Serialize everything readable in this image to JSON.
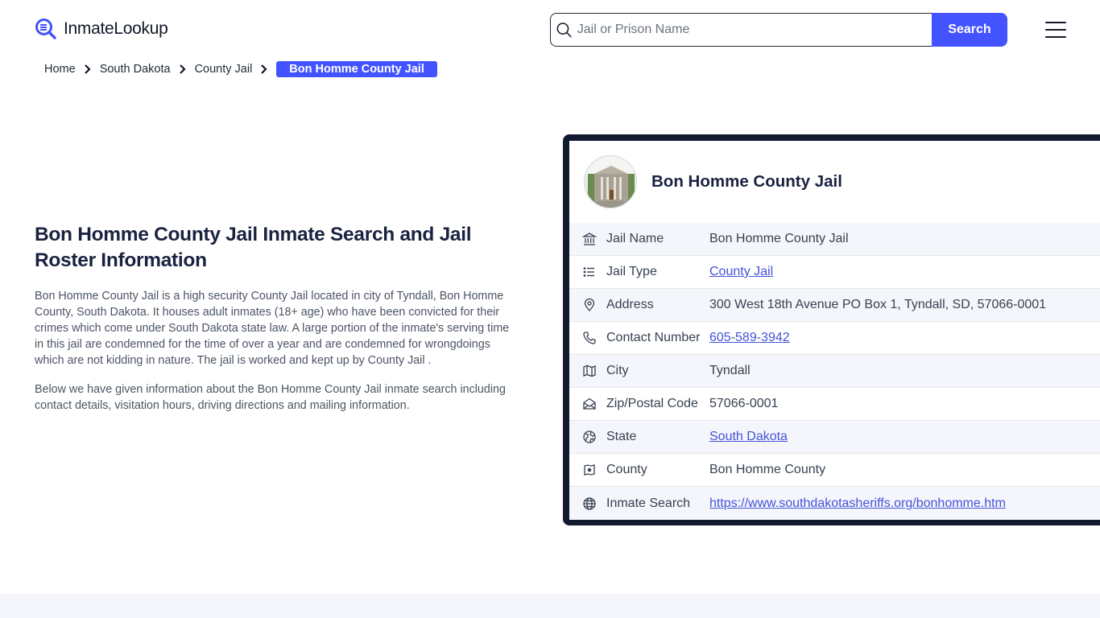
{
  "header": {
    "logo_text": "InmateLookup",
    "search_placeholder": "Jail or Prison Name",
    "search_value": "",
    "search_button": "Search",
    "menu_icon": "hamburger-menu-icon",
    "accent_color": "#4353ff"
  },
  "breadcrumb": {
    "items": [
      {
        "label": "Home"
      },
      {
        "label": "South Dakota"
      },
      {
        "label": "County Jail"
      }
    ],
    "current": "Bon Homme County Jail"
  },
  "main": {
    "title": "Bon Homme County Jail Inmate Search and Jail Roster Information",
    "paragraphs": [
      "Bon Homme County Jail is a high security County Jail located in city of Tyndall, Bon Homme County, South Dakota. It houses adult inmates (18+ age) who have been convicted for their crimes which come under South Dakota state law. A large portion of the inmate's serving time in this jail are condemned for the time of over a year and are condemned for wrongdoings which are not kidding in nature. The jail is worked and kept up by County Jail .",
      "Below we have given information about the Bon Homme County Jail inmate search including contact details, visitation hours, driving directions and mailing information."
    ]
  },
  "card": {
    "title": "Bon Homme County Jail",
    "rows": [
      {
        "icon": "bank-icon",
        "label": "Jail Name",
        "value": "Bon Homme County Jail",
        "link": false
      },
      {
        "icon": "list-icon",
        "label": "Jail Type",
        "value": "County Jail",
        "link": true
      },
      {
        "icon": "map-pin-icon",
        "label": "Address",
        "value": "300 West 18th Avenue PO Box 1, Tyndall, SD, 57066-0001",
        "link": false
      },
      {
        "icon": "phone-icon",
        "label": "Contact Number",
        "value": "605-589-3942",
        "link": true
      },
      {
        "icon": "map-icon",
        "label": "City",
        "value": "Tyndall",
        "link": false
      },
      {
        "icon": "mail-open-icon",
        "label": "Zip/Postal Code",
        "value": "57066-0001",
        "link": false
      },
      {
        "icon": "globe-earth-icon",
        "label": "State",
        "value": "South Dakota",
        "link": true
      },
      {
        "icon": "county-map-icon",
        "label": "County",
        "value": "Bon Homme County",
        "link": false
      },
      {
        "icon": "globe-icon",
        "label": "Inmate Search",
        "value": "https://www.southdakotasheriffs.org/bonhomme.htm",
        "link": true
      }
    ]
  }
}
